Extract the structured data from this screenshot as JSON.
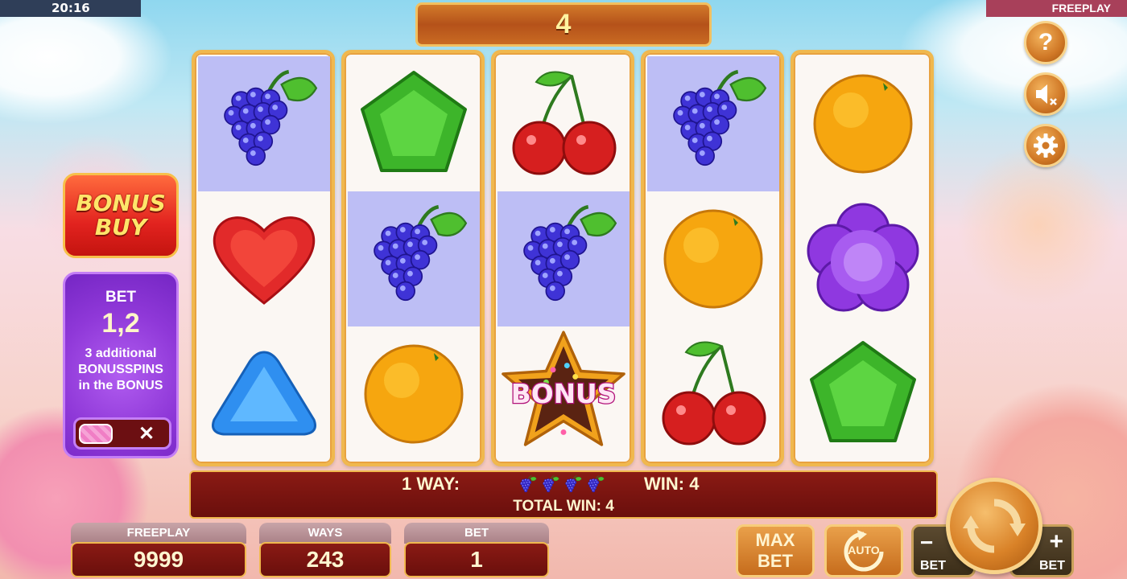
{
  "status_bar": {
    "time": "20:16",
    "mode": "FREEPLAY"
  },
  "top_counter": "4",
  "side_buttons": [
    {
      "name": "help-button",
      "icon": "question-icon",
      "glyph": "?"
    },
    {
      "name": "sound-button",
      "icon": "sound-muted-icon"
    },
    {
      "name": "settings-button",
      "icon": "gear-icon"
    }
  ],
  "bonus_buy": {
    "line1": "BONUS",
    "line2": "BUY"
  },
  "bet_panel": {
    "label": "BET",
    "value": "1,2",
    "text_line1": "3 additional",
    "text_line2": "BONUSSPINS",
    "text_line3": "in the BONUS",
    "toggle_off_glyph": "✕"
  },
  "reels": [
    [
      {
        "symbol": "grapes",
        "highlight": true
      },
      {
        "symbol": "red-heart",
        "highlight": false
      },
      {
        "symbol": "blue-triangle",
        "highlight": false
      }
    ],
    [
      {
        "symbol": "green-pentagon",
        "highlight": false
      },
      {
        "symbol": "grapes",
        "highlight": true
      },
      {
        "symbol": "orange",
        "highlight": false
      }
    ],
    [
      {
        "symbol": "cherries",
        "highlight": false
      },
      {
        "symbol": "grapes",
        "highlight": true
      },
      {
        "symbol": "bonus-star",
        "highlight": false,
        "label": "BONUS"
      }
    ],
    [
      {
        "symbol": "grapes",
        "highlight": true
      },
      {
        "symbol": "orange",
        "highlight": false
      },
      {
        "symbol": "cherries",
        "highlight": false
      }
    ],
    [
      {
        "symbol": "orange",
        "highlight": false
      },
      {
        "symbol": "purple-flower",
        "highlight": false
      },
      {
        "symbol": "green-pentagon",
        "highlight": false
      }
    ]
  ],
  "win_panel": {
    "ways_text": "1 WAY:",
    "ways_symbol": "grapes",
    "ways_symbol_count": 4,
    "win_text": "WIN: 4",
    "total_win_text": "TOTAL WIN: 4"
  },
  "info": {
    "freeplay_label": "FREEPLAY",
    "freeplay_value": "9999",
    "ways_label": "WAYS",
    "ways_value": "243",
    "bet_label": "BET",
    "bet_value": "1"
  },
  "controls": {
    "max_bet_line1": "MAX",
    "max_bet_line2": "BET",
    "auto_label": "AUTO",
    "bet_minus_glyph": "−",
    "bet_minus_label": "BET",
    "bet_plus_glyph": "+",
    "bet_plus_label": "BET"
  },
  "colors": {
    "highlight": "#bdbef5",
    "gold_border": "#f0b84e",
    "panel_dark_red": "#6a0f0c",
    "bonus_buy_red": "#e2231f",
    "bet_panel_purple": "#8f38d8"
  }
}
